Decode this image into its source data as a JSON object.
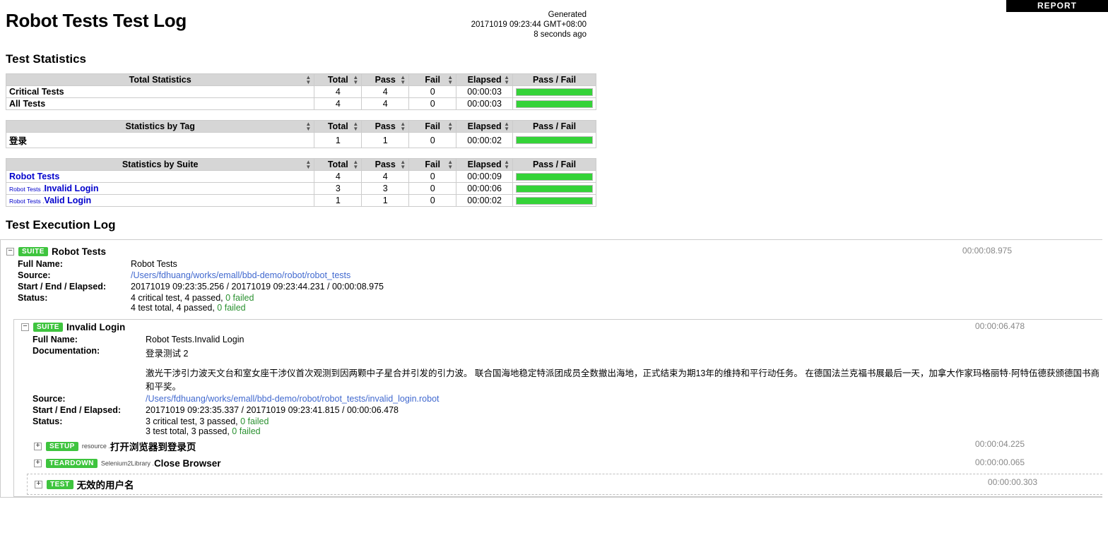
{
  "report_link": {
    "label": "REPORT"
  },
  "header": {
    "title": "Robot Tests Test Log",
    "generated_label": "Generated",
    "generated_time": "20171019 09:23:44 GMT+08:00",
    "generated_ago": "8 seconds ago"
  },
  "sections": {
    "statistics_title": "Test Statistics",
    "execution_title": "Test Execution Log"
  },
  "columns": {
    "total": "Total",
    "pass": "Pass",
    "fail": "Fail",
    "elapsed": "Elapsed",
    "graph": "Pass / Fail"
  },
  "tables": {
    "total_statistics": {
      "title": "Total Statistics",
      "rows": [
        {
          "name": "Critical Tests",
          "total": "4",
          "pass": "4",
          "fail": "0",
          "elapsed": "00:00:03",
          "pass_pct": 100
        },
        {
          "name": "All Tests",
          "total": "4",
          "pass": "4",
          "fail": "0",
          "elapsed": "00:00:03",
          "pass_pct": 100
        }
      ]
    },
    "statistics_by_tag": {
      "title": "Statistics by Tag",
      "rows": [
        {
          "name": "登录",
          "total": "1",
          "pass": "1",
          "fail": "0",
          "elapsed": "00:00:02",
          "pass_pct": 100
        }
      ]
    },
    "statistics_by_suite": {
      "title": "Statistics by Suite",
      "rows": [
        {
          "parent": "",
          "name": "Robot Tests",
          "total": "4",
          "pass": "4",
          "fail": "0",
          "elapsed": "00:00:09",
          "pass_pct": 100
        },
        {
          "parent": "Robot Tests .",
          "name": "Invalid Login",
          "total": "3",
          "pass": "3",
          "fail": "0",
          "elapsed": "00:00:06",
          "pass_pct": 100
        },
        {
          "parent": "Robot Tests .",
          "name": "Valid Login",
          "total": "1",
          "pass": "1",
          "fail": "0",
          "elapsed": "00:00:02",
          "pass_pct": 100
        }
      ]
    }
  },
  "labels": {
    "full_name": "Full Name:",
    "source": "Source:",
    "start_end_elapsed": "Start / End / Elapsed:",
    "status": "Status:",
    "documentation": "Documentation:"
  },
  "root_suite": {
    "toggle": "−",
    "badge": "SUITE",
    "name": "Robot Tests",
    "elapsed": "00:00:08.975",
    "full_name": "Robot Tests",
    "source": "/Users/fdhuang/works/emall/bbd-demo/robot/robot_tests",
    "start_end": "20171019 09:23:35.256 / 20171019 09:23:44.231 / 00:00:08.975",
    "status_line1_pre": "4 critical test, 4 passed, ",
    "status_line1_fail": "0 failed",
    "status_line2_pre": "4 test total, 4 passed, ",
    "status_line2_fail": "0 failed"
  },
  "child_suite": {
    "toggle": "−",
    "badge": "SUITE",
    "name": "Invalid Login",
    "elapsed": "00:00:06.478",
    "full_name": "Robot Tests.Invalid Login",
    "documentation_title": "登录测试 2",
    "documentation_body": "激光干涉引力波天文台和室女座干涉仪首次观测到因两颗中子星合并引发的引力波。 联合国海地稳定特派团成员全数撤出海地，正式结束为期13年的维持和平行动任务。 在德国法兰克福书展最后一天，加拿大作家玛格丽特·阿特伍德获颁德国书商和平奖。",
    "source": "/Users/fdhuang/works/emall/bbd-demo/robot/robot_tests/invalid_login.robot",
    "start_end": "20171019 09:23:35.337 / 20171019 09:23:41.815 / 00:00:06.478",
    "status_line1_pre": "3 critical test, 3 passed, ",
    "status_line1_fail": "0 failed",
    "status_line2_pre": "3 test total, 3 passed, ",
    "status_line2_fail": "0 failed"
  },
  "keywords": [
    {
      "toggle": "+",
      "badge": "SETUP",
      "prefix": "resource .",
      "name": "打开浏览器到登录页",
      "elapsed": "00:00:04.225"
    },
    {
      "toggle": "+",
      "badge": "TEARDOWN",
      "prefix": "Selenium2Library .",
      "name": "Close Browser",
      "elapsed": "00:00:00.065"
    }
  ],
  "test_case": {
    "toggle": "+",
    "badge": "TEST",
    "name": "无效的用户名",
    "elapsed": "00:00:00.303"
  },
  "colors": {
    "pass_green": "#34d338",
    "badge_green": "#3ec43e",
    "link_blue": "#0000cc",
    "source_blue": "#4169cf",
    "header_gray": "#d6d6d6",
    "elapsed_gray": "#888888"
  }
}
